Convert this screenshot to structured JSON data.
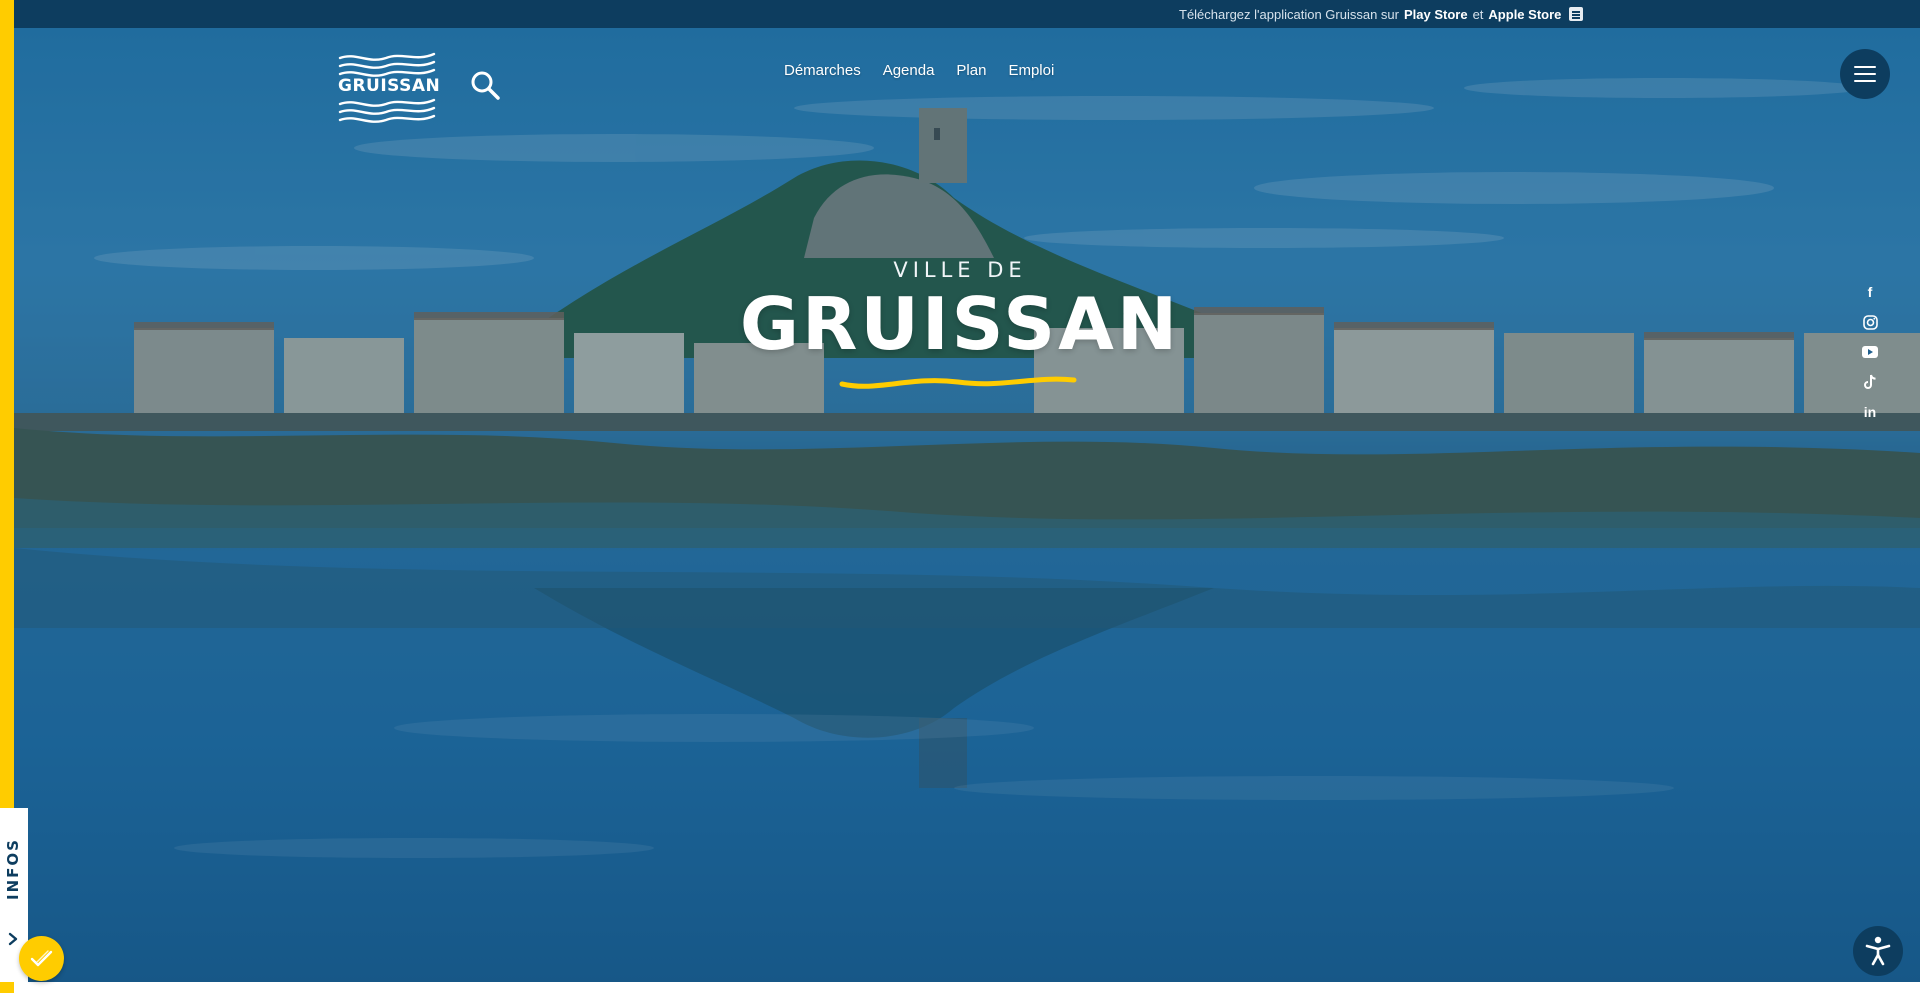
{
  "topbar": {
    "prefix": "Téléchargez l'application Gruissan sur",
    "play_store": "Play Store",
    "conjunction": "et",
    "apple_store": "Apple Store",
    "icon": "app-store-icon"
  },
  "header": {
    "logo_text": "GRUISSAN",
    "search_icon": "search-icon",
    "nav": [
      {
        "label": "Démarches"
      },
      {
        "label": "Agenda"
      },
      {
        "label": "Plan"
      },
      {
        "label": "Emploi"
      }
    ],
    "menu_icon": "hamburger-menu-icon"
  },
  "hero": {
    "pre_title": "VILLE DE",
    "title": "GRUISSAN",
    "accent_color": "#ffcc00"
  },
  "social": [
    {
      "name": "facebook-icon",
      "glyph": "f"
    },
    {
      "name": "instagram-icon",
      "glyph": ""
    },
    {
      "name": "youtube-icon",
      "glyph": ""
    },
    {
      "name": "tiktok-icon",
      "glyph": ""
    },
    {
      "name": "linkedin-icon",
      "glyph": "in"
    }
  ],
  "infos_tab": {
    "label": "INFOS",
    "icon": "chevron-right-icon"
  },
  "cookie_badge": {
    "icon": "cookie-check-icon"
  },
  "accessibility": {
    "icon": "accessibility-icon"
  },
  "colors": {
    "navy": "#0d3d5f",
    "yellow": "#ffcc00",
    "white": "#ffffff"
  }
}
